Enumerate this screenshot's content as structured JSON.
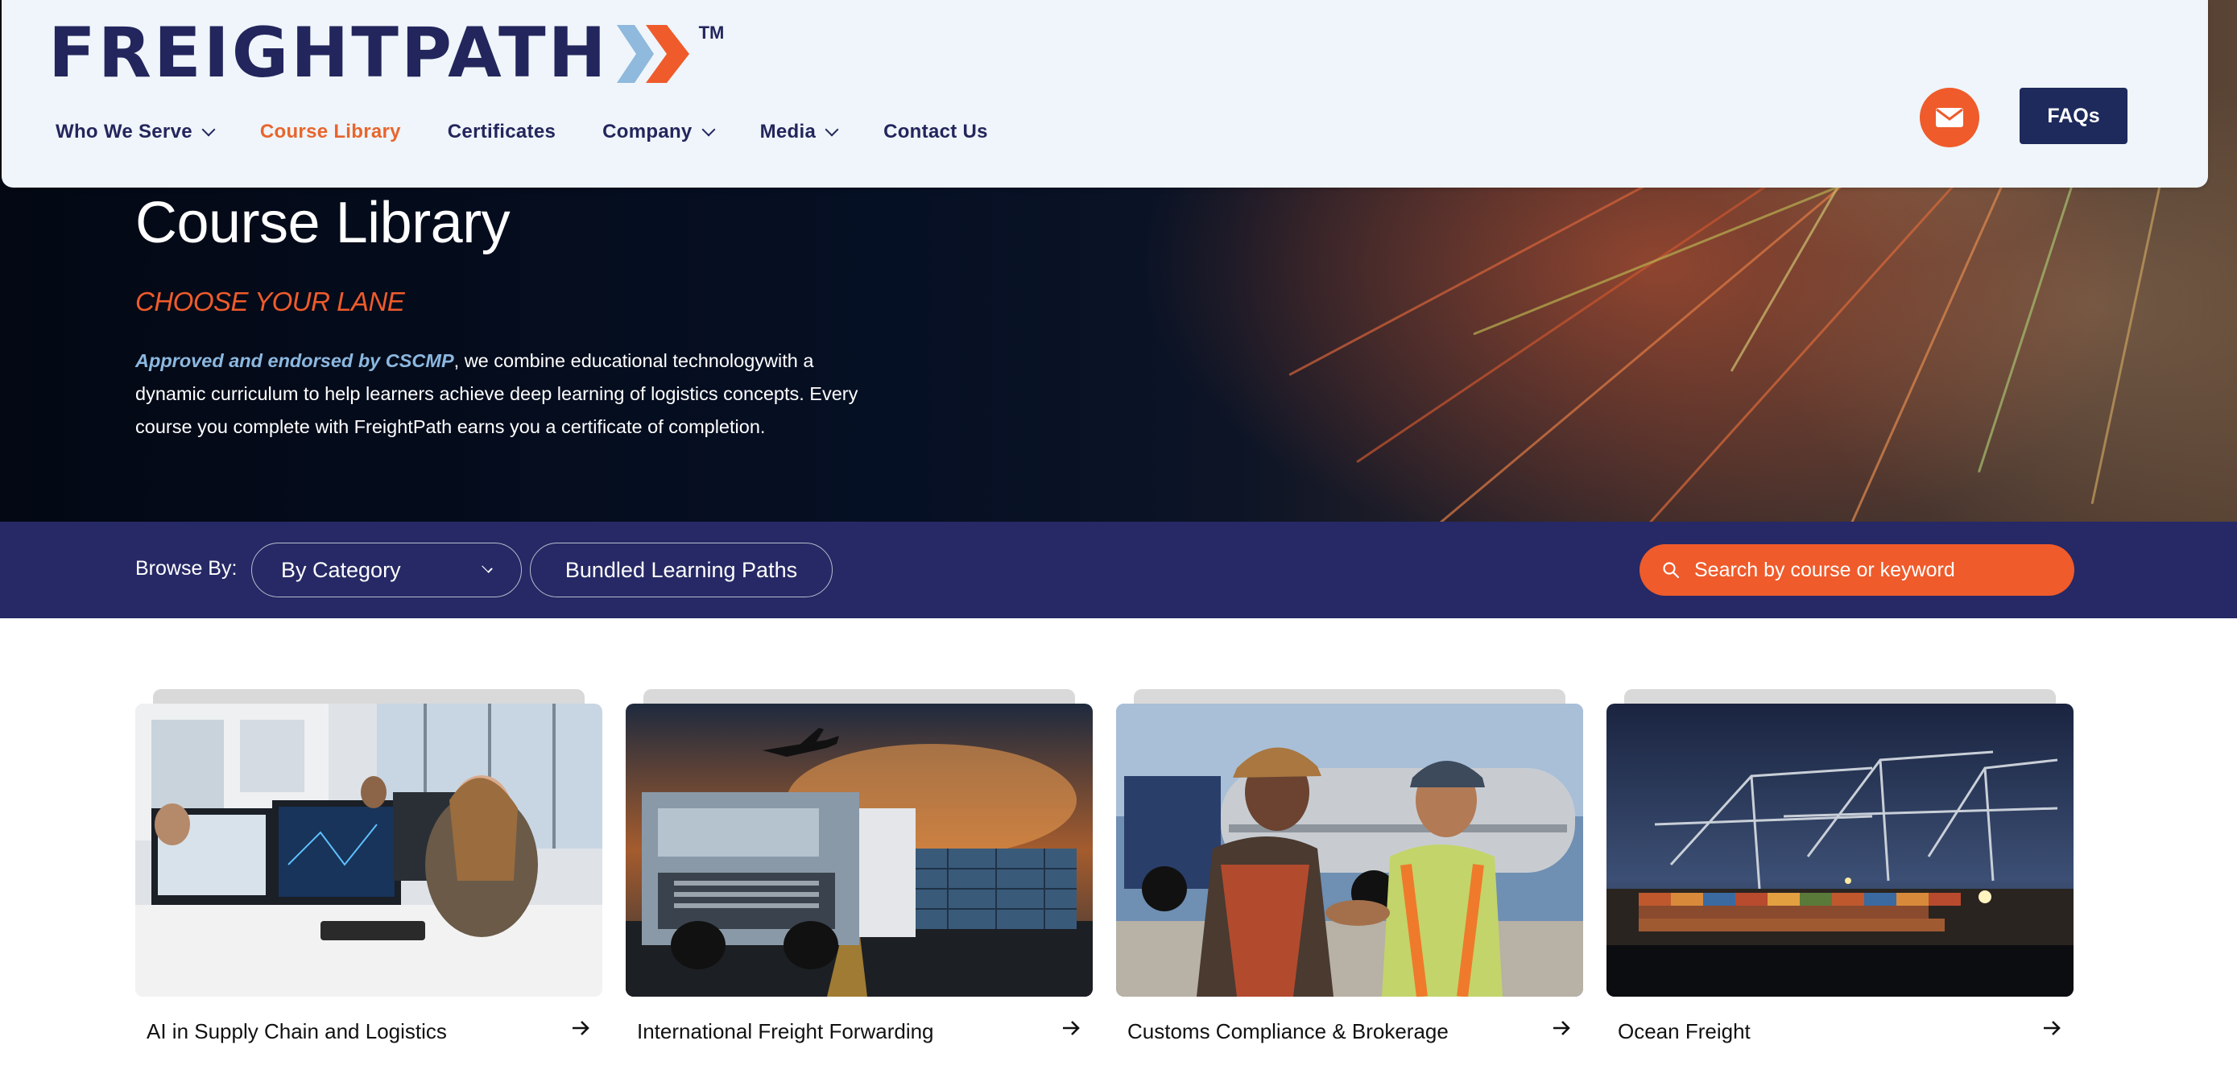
{
  "header": {
    "logo_text": "FREIGHTPATH",
    "logo_tm": "TM",
    "nav": [
      {
        "label": "Who We Serve",
        "dropdown": true,
        "active": false
      },
      {
        "label": "Course Library",
        "dropdown": false,
        "active": true
      },
      {
        "label": "Certificates",
        "dropdown": false,
        "active": false
      },
      {
        "label": "Company",
        "dropdown": true,
        "active": false
      },
      {
        "label": "Media",
        "dropdown": true,
        "active": false
      },
      {
        "label": "Contact Us",
        "dropdown": false,
        "active": false
      }
    ],
    "mail_icon": "envelope-icon",
    "faq_label": "FAQs"
  },
  "hero": {
    "title": "Course Library",
    "subtitle": "CHOOSE YOUR LANE",
    "desc_em": "Approved and endorsed by CSCMP",
    "desc_rest": ", we combine educational technologywith a dynamic curriculum to help learners achieve deep learning of logistics concepts. Every course you complete with FreightPath earns you a certificate of completion."
  },
  "browse": {
    "label": "Browse By:",
    "category_value": "By Category",
    "bundle_label": "Bundled Learning Paths",
    "search_placeholder": "Search by course or keyword"
  },
  "courses": [
    {
      "title": "AI in Supply Chain and Logistics"
    },
    {
      "title": "International Freight Forwarding"
    },
    {
      "title": "Customs Compliance & Brokerage"
    },
    {
      "title": "Ocean Freight"
    }
  ],
  "colors": {
    "navy": "#23265c",
    "orange": "#ef5b2b",
    "browse_bar": "#262965",
    "header_bg": "#eff5fa"
  }
}
